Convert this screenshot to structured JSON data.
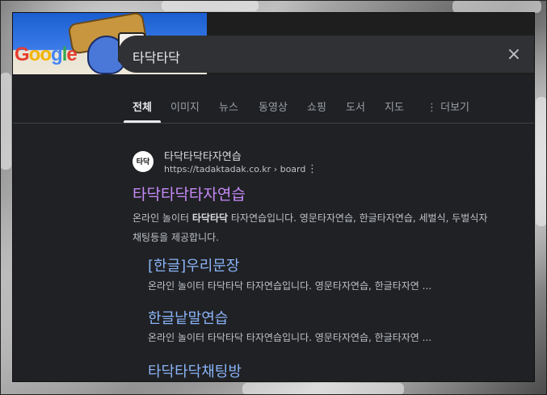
{
  "search": {
    "query": "타닥타닥",
    "close_icon": "×"
  },
  "doodle": {
    "logo_letters": [
      "G",
      "o",
      "o",
      "g",
      "l",
      "e"
    ]
  },
  "tabs": [
    {
      "label": "전체",
      "active": true
    },
    {
      "label": "이미지",
      "active": false
    },
    {
      "label": "뉴스",
      "active": false
    },
    {
      "label": "동영상",
      "active": false
    },
    {
      "label": "쇼핑",
      "active": false
    },
    {
      "label": "도서",
      "active": false
    },
    {
      "label": "지도",
      "active": false
    },
    {
      "label": "더보기",
      "active": false
    }
  ],
  "more_icon": "⋮",
  "result": {
    "site_name": "타닥타닥타자연습",
    "favicon_text": "타닥",
    "url": "https://tadaktadak.co.kr › board",
    "url_menu": "⋮",
    "title": "타닥타닥타자연습",
    "snippet_prefix": "온라인 놀이터 ",
    "snippet_bold": "타닥타닥",
    "snippet_suffix": " 타자연습입니다. 영문타자연습, 한글타자연습, 세벌식, 두벌식자",
    "snippet_line2": "채팅등을 제공합니다.",
    "sitelinks": [
      {
        "title": "[한글]우리문장",
        "desc": "온라인 놀이터 타닥타닥 타자연습입니다. 영문타자연습, 한글타자연 ..."
      },
      {
        "title": "한글낱말연습",
        "desc": "온라인 놀이터 타닥타닥 타자연습입니다. 영문타자연습, 한글타자연 ..."
      },
      {
        "title": "타닥타닥채팅방",
        "desc": ""
      }
    ]
  },
  "colors": {
    "panel_bg": "#202124",
    "visited_link": "#c58af9",
    "link": "#8ab4f8"
  }
}
